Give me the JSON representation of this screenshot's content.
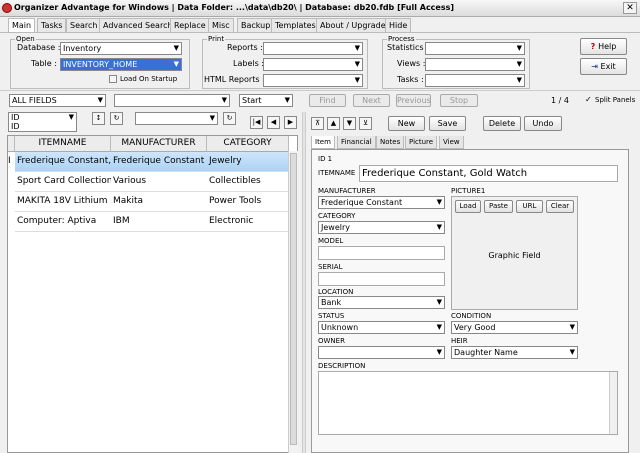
{
  "window": {
    "title": "Organizer Advantage for Windows | Data Folder: ...\\data\\db20\\ | Database: db20.fdb [Full Access]",
    "close": "✕"
  },
  "tabs": [
    "Main",
    "Tasks",
    "Search",
    "Advanced Search",
    "Replace",
    "Misc",
    "Backup",
    "Templates",
    "About / Upgrade",
    "Hide"
  ],
  "open": {
    "legend": "Open",
    "database_label": "Database :",
    "database_value": "Inventory",
    "table_label": "Table :",
    "table_value": "INVENTORY_HOME",
    "load_on_startup": "Load On Startup"
  },
  "print": {
    "legend": "Print",
    "reports_label": "Reports :",
    "labels_label": "Labels :",
    "html_reports_label": "HTML Reports :"
  },
  "process": {
    "legend": "Process",
    "statistics_label": "Statistics :",
    "views_label": "Views :",
    "tasks_label": "Tasks :"
  },
  "help_button": "Help",
  "exit_button": "Exit",
  "search": {
    "field": "ALL FIELDS",
    "mode": "Start",
    "find": "Find",
    "next": "Next",
    "previous": "Previous",
    "stop": "Stop",
    "record_count": "1 / 4",
    "split_panels": "Split Panels"
  },
  "sort": {
    "field_top": "ID",
    "field_bottom": "ID",
    "arrow_updown": "↕",
    "refresh": "↻"
  },
  "nav": {
    "first": "|◀",
    "prev": "◀",
    "next": "▶"
  },
  "grid": {
    "columns": [
      "ITEMNAME",
      "MANUFACTURER",
      "CATEGORY"
    ],
    "indicator": "I",
    "rows": [
      [
        "Frederique Constant,",
        "Frederique Constant",
        "Jewelry"
      ],
      [
        "Sport Card Collection",
        "Various",
        "Collectibles"
      ],
      [
        "MAKITA 18V Lithium",
        "Makita",
        "Power Tools"
      ],
      [
        "Computer: Aptiva",
        "IBM",
        "Electronic"
      ]
    ]
  },
  "record_toolbar": {
    "first": "⊼",
    "up": "▲",
    "down": "▼",
    "last": "⊻",
    "new": "New",
    "save": "Save",
    "delete": "Delete",
    "undo": "Undo"
  },
  "item_tabs": [
    "Item",
    "Financial",
    "Notes",
    "Picture",
    "View"
  ],
  "record": {
    "id_label": "ID 1",
    "itemname_label": "ITEMNAME",
    "itemname": "Frederique Constant, Gold Watch",
    "manufacturer_label": "MANUFACTURER",
    "manufacturer": "Frederique Constant",
    "category_label": "CATEGORY",
    "category": "Jewelry",
    "model_label": "MODEL",
    "model": "",
    "serial_label": "SERIAL",
    "serial": "",
    "location_label": "LOCATION",
    "location": "Bank",
    "status_label": "STATUS",
    "status": "Unknown",
    "owner_label": "OWNER",
    "owner": "",
    "condition_label": "CONDITION",
    "condition": "Very Good",
    "heir_label": "HEIR",
    "heir": "Daughter Name",
    "description_label": "DESCRIPTION",
    "picture_label": "PICTURE1",
    "picture_load": "Load",
    "picture_paste": "Paste",
    "picture_url": "URL",
    "picture_clear": "Clear",
    "graphic": "Graphic Field"
  }
}
